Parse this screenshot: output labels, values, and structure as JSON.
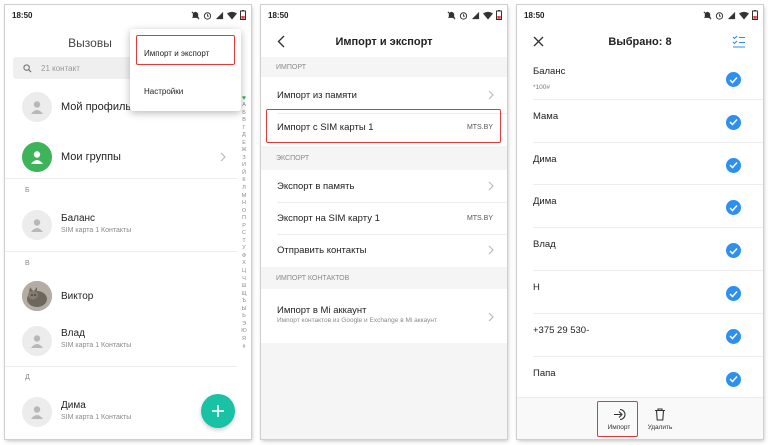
{
  "status": {
    "time": "18:50"
  },
  "contacts": {
    "title": "Вызовы",
    "search_placeholder": "21 контакт",
    "my_profile": "Мой профиль",
    "my_groups": "Мои группы",
    "sections": [
      "Б",
      "В",
      "Д"
    ],
    "entries": [
      {
        "name": "Баланс",
        "sub": "SIM карта 1 Контакты"
      },
      {
        "name": "Виктор",
        "sub": ""
      },
      {
        "name": "Влад",
        "sub": "SIM карта 1 Контакты"
      },
      {
        "name": "Дима",
        "sub": "SIM карта 1 Контакты"
      }
    ],
    "alphabet": [
      "А",
      "Б",
      "В",
      "Г",
      "Д",
      "Е",
      "Ж",
      "З",
      "И",
      "Й",
      "К",
      "Л",
      "М",
      "Н",
      "О",
      "П",
      "Р",
      "С",
      "Т",
      "У",
      "Ф",
      "Х",
      "Ц",
      "Ч",
      "Ш",
      "Щ",
      "Ъ",
      "Ы",
      "Ь",
      "Э",
      "Ю",
      "Я",
      "#"
    ],
    "menu": {
      "import_export": "Импорт и экспорт",
      "settings": "Настройки"
    }
  },
  "import_export": {
    "title": "Импорт и экспорт",
    "import_header": "ИМПОРТ",
    "import_from_memory": "Импорт из памяти",
    "import_from_sim": "Импорт с SIM карты 1",
    "sim_operator": "MTS.BY",
    "export_header": "ЭКСПОРТ",
    "export_to_memory": "Экспорт в память",
    "export_to_sim": "Экспорт на SIM карту 1",
    "send_contacts": "Отправить контакты",
    "import_contacts_header": "ИМПОРТ КОНТАКТОВ",
    "import_mi": "Импорт в Mi аккаунт",
    "import_mi_sub": "Импорт контактов из Google и Exchange в Mi аккаунт"
  },
  "selection": {
    "title": "Выбрано: 8",
    "items": [
      {
        "name": "Баланс",
        "sub": "*100#"
      },
      {
        "name": "Мама",
        "sub": ""
      },
      {
        "name": "Дима",
        "sub": ""
      },
      {
        "name": "Дима",
        "sub": ""
      },
      {
        "name": "Влад",
        "sub": ""
      },
      {
        "name": "Н",
        "sub": ""
      },
      {
        "name": "+375 29 530-",
        "sub": ""
      },
      {
        "name": "Папа",
        "sub": ""
      }
    ],
    "import_label": "Импорт",
    "delete_label": "Удалить"
  },
  "colors": {
    "accent_green": "#3db35a",
    "fab": "#19c1a5",
    "check_blue": "#2d8ff0",
    "highlight_red": "#e03a3a"
  }
}
